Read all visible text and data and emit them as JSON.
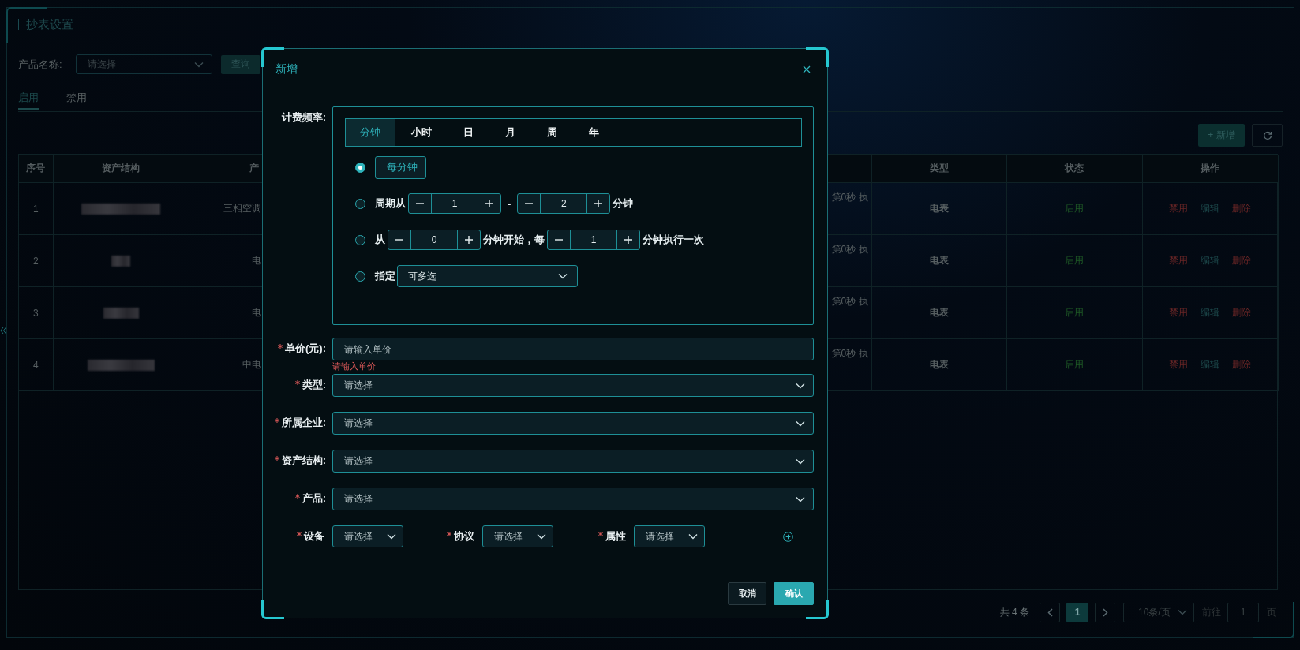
{
  "page": {
    "title": "抄表设置",
    "filter": {
      "label": "产品名称:",
      "placeholder": "请选择",
      "button": "查询"
    },
    "tabs": [
      {
        "label": "启用",
        "selected": true
      },
      {
        "label": "禁用",
        "selected": false
      }
    ],
    "toolbar": {
      "add_button": "+ 新增"
    },
    "table": {
      "columns": [
        {
          "label": "序号"
        },
        {
          "label": "资产结构"
        },
        {
          "label": "产"
        },
        {},
        {
          "label": "类型"
        },
        {
          "label": "状态"
        },
        {
          "label": "操作"
        }
      ],
      "rows": [
        {
          "index": "1",
          "asset_redacted": true,
          "column_3": "三相空调",
          "column_4": "第0秒 执",
          "type": "电表",
          "status": "启用",
          "actions": [
            {
              "label": "禁用",
              "kind": "danger"
            },
            {
              "label": "编辑",
              "kind": "edit"
            },
            {
              "label": "删除",
              "kind": "danger"
            }
          ]
        },
        {
          "index": "2",
          "asset_redacted": true,
          "column_3": "电",
          "column_4": "第0秒 执",
          "type": "电表",
          "status": "启用",
          "actions": [
            {
              "label": "禁用",
              "kind": "danger"
            },
            {
              "label": "编辑",
              "kind": "edit"
            },
            {
              "label": "删除",
              "kind": "danger"
            }
          ]
        },
        {
          "index": "3",
          "asset_redacted": true,
          "column_3": "电",
          "column_4": "第0秒 执",
          "type": "电表",
          "status": "启用",
          "actions": [
            {
              "label": "禁用",
              "kind": "danger"
            },
            {
              "label": "编辑",
              "kind": "edit"
            },
            {
              "label": "删除",
              "kind": "danger"
            }
          ]
        },
        {
          "index": "4",
          "asset_redacted": true,
          "column_3": "中电",
          "column_4": "第0秒 执",
          "type": "电表",
          "status": "启用",
          "actions": [
            {
              "label": "禁用",
              "kind": "danger"
            },
            {
              "label": "编辑",
              "kind": "edit"
            },
            {
              "label": "删除",
              "kind": "danger"
            }
          ]
        }
      ]
    },
    "pagination": {
      "total": "共 4 条",
      "pages": [
        {
          "label": "1",
          "selected": true
        }
      ],
      "page_size": "10条/页",
      "goto_label": "前往",
      "goto_value": "1",
      "goto_suffix": "页"
    }
  },
  "modal": {
    "title": "新增",
    "frequency": {
      "label": "计费频率:",
      "tabs": [
        {
          "label": "分钟",
          "selected": true
        },
        {
          "label": "小时",
          "selected": false
        },
        {
          "label": "日",
          "selected": false
        },
        {
          "label": "月",
          "selected": false
        },
        {
          "label": "周",
          "selected": false
        },
        {
          "label": "年",
          "selected": false
        }
      ],
      "options": [
        {
          "kind": "every",
          "selected": true,
          "label": "每分钟"
        },
        {
          "kind": "range",
          "selected": false,
          "prefix": "周期从",
          "from": "1",
          "separator": "-",
          "to": "2",
          "suffix": "分钟"
        },
        {
          "kind": "step",
          "selected": false,
          "prefix": "从",
          "start": "0",
          "middle": "分钟开始，每",
          "step": "1",
          "suffix": "分钟执行一次"
        },
        {
          "kind": "specific",
          "selected": false,
          "prefix": "指定",
          "placeholder": "可多选"
        }
      ]
    },
    "fields": [
      {
        "label": "单价(元):",
        "required": true,
        "kind": "input",
        "placeholder": "请输入单价",
        "error": "请输入单价"
      },
      {
        "label": "类型:",
        "required": true,
        "kind": "select",
        "placeholder": "请选择"
      },
      {
        "label": "所属企业:",
        "required": true,
        "kind": "select",
        "placeholder": "请选择"
      },
      {
        "label": "资产结构:",
        "required": true,
        "kind": "select",
        "placeholder": "请选择"
      },
      {
        "label": "产品:",
        "required": true,
        "kind": "select",
        "placeholder": "请选择"
      }
    ],
    "inline_fields": [
      {
        "label": "设备",
        "required": true,
        "placeholder": "请选择"
      },
      {
        "label": "协议",
        "required": true,
        "placeholder": "请选择"
      },
      {
        "label": "属性",
        "required": true,
        "placeholder": "请选择"
      }
    ],
    "buttons": [
      {
        "label": "取消",
        "kind": "secondary"
      },
      {
        "label": "确认",
        "kind": "primary"
      }
    ]
  }
}
